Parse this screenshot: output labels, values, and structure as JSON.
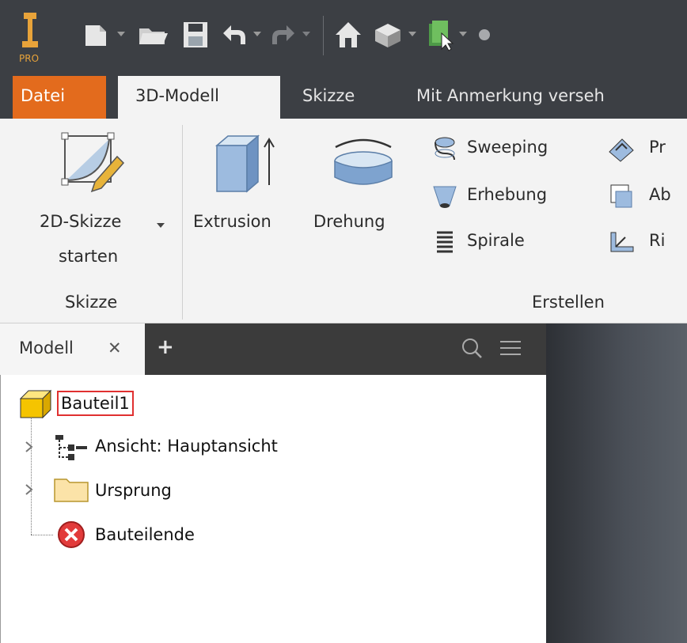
{
  "app": {
    "logo_caption": "PRO"
  },
  "tabs": {
    "file": "Datei",
    "model": "3D-Modell",
    "sketch": "Skizze",
    "annotate": "Mit Anmerkung verseh"
  },
  "ribbon": {
    "sketch_btn_line1": "2D-Skizze",
    "sketch_btn_line2": "starten",
    "sketch_panel": "Skizze",
    "extrusion": "Extrusion",
    "revolve": "Drehung",
    "sweep": "Sweeping",
    "loft": "Erhebung",
    "coil": "Spirale",
    "emboss_partial": "Pr",
    "derive_partial": "Ab",
    "rib_partial": "Ri",
    "create_panel": "Erstellen"
  },
  "browser": {
    "tab_label": "Modell",
    "close": "✕",
    "add": "+",
    "tree": {
      "root": "Bauteil1",
      "view": "Ansicht: Hauptansicht",
      "origin": "Ursprung",
      "end": "Bauteilende"
    }
  },
  "colors": {
    "file_tab": "#e36b1d",
    "dark_bar": "#3c3f44",
    "ribbon_bg": "#f3f3f3",
    "root_highlight": "#e03030"
  }
}
